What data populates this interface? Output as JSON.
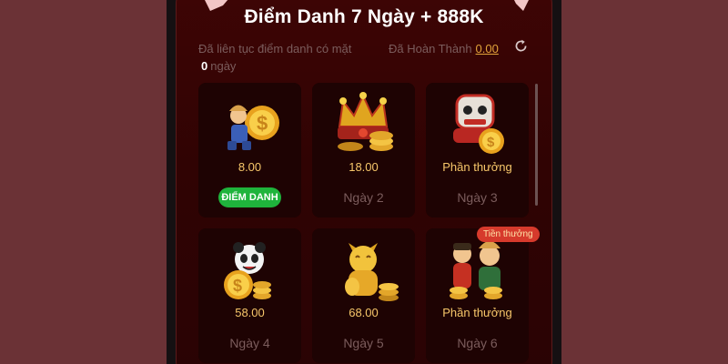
{
  "header": {
    "title": "Điểm Danh 7 Ngày + 888K",
    "streak_label": "Đã liên tục điểm danh có mặt",
    "streak_days": "0",
    "streak_unit": "ngày",
    "completed_label": "Đã Hoàn Thành",
    "completed_value": "0.00"
  },
  "cards": [
    {
      "reward": "8.00",
      "day": "",
      "button": "ĐIỂM DANH",
      "art": "player-coin-icon"
    },
    {
      "reward": "18.00",
      "day": "Ngày 2",
      "art": "jester-crown-coins-icon"
    },
    {
      "reward": "Phần thưởng",
      "day": "Ngày 3",
      "art": "lion-dance-coins-icon"
    },
    {
      "reward": "58.00",
      "day": "Ngày 4",
      "art": "panda-coins-icon"
    },
    {
      "reward": "68.00",
      "day": "Ngày 5",
      "art": "lucky-cat-coins-icon"
    },
    {
      "reward": "Phần thưởng",
      "day": "Ngày 6",
      "art": "fortune-god-coins-icon",
      "badge": "Tiền thưởng"
    }
  ],
  "colors": {
    "background": "#6b3236",
    "panel": "#3e0505",
    "card": "#1e0303",
    "accent_gold": "#f7c76a",
    "button_green": "#1fb43c",
    "badge_red": "#d63a2c"
  }
}
